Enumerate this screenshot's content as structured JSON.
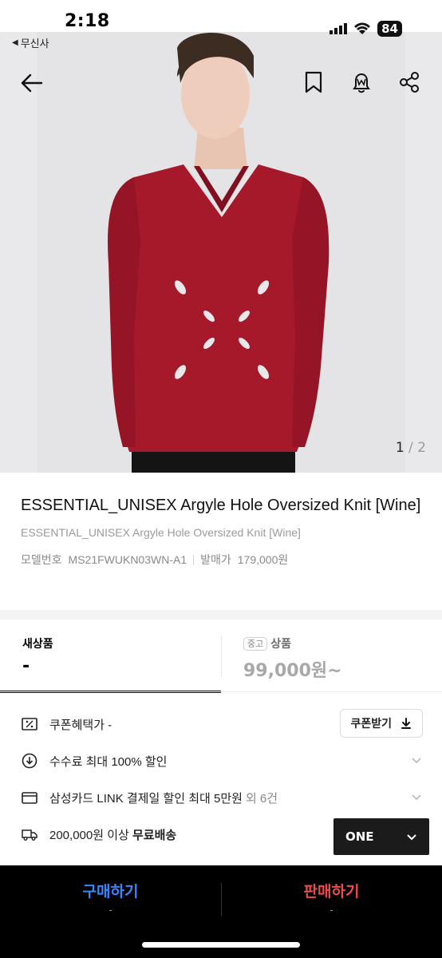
{
  "status": {
    "time": "2:18",
    "back_app": "무신사",
    "battery": "84"
  },
  "hero": {
    "pager_current": "1",
    "pager_total": "/ 2"
  },
  "product": {
    "title": "ESSENTIAL_UNISEX Argyle Hole Oversized Knit [Wine]",
    "subtitle": "ESSENTIAL_UNISEX Argyle Hole Oversized Knit [Wine]",
    "model_label": "모델번호",
    "model_value": "MS21FWUKN03WN-A1",
    "release_label": "발매가",
    "release_value": "179,000원"
  },
  "price_tabs": {
    "new_label": "새상품",
    "new_value": "-",
    "used_badge": "중고",
    "used_label": "상품",
    "used_value": "99,000원~"
  },
  "benefits": {
    "coupon_label": "쿠폰혜택가 -",
    "coupon_button": "쿠폰받기",
    "fee_label": "수수료 최대 100% 할인",
    "card_label": "삼성카드 LINK 결제일 할인 최대 5만원",
    "card_more": "외 6건",
    "shipping_prefix": "200,000원 이상 ",
    "shipping_bold": "무료배송"
  },
  "size_select": {
    "value": "ONE"
  },
  "bottom_bar": {
    "buy_label": "구매하기",
    "buy_sub": "-",
    "sell_label": "판매하기",
    "sell_sub": "-"
  },
  "colors": {
    "buy": "#3b86ff",
    "sell": "#ef4b4b",
    "knit": "#a5192a"
  }
}
